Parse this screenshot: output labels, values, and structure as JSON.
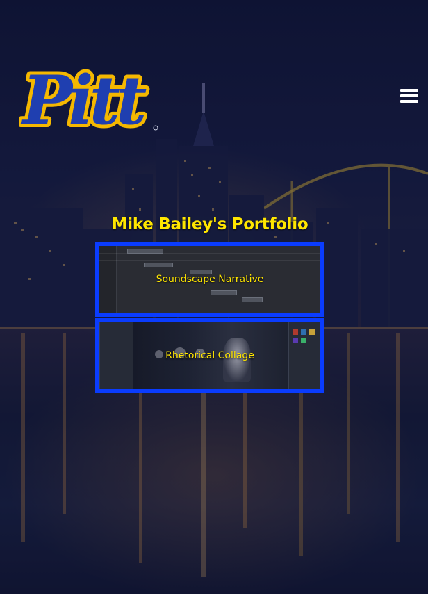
{
  "header": {
    "logo_text": "Pitt",
    "menu_icon": "hamburger-menu-icon"
  },
  "main": {
    "title": "Mike Bailey's Portfolio",
    "cards": [
      {
        "label": "Soundscape Narrative"
      },
      {
        "label": "Rhetorical Collage"
      }
    ]
  },
  "colors": {
    "title_yellow": "#ffe600",
    "card_border_blue": "#0a3cff",
    "logo_blue": "#1f3fb0",
    "logo_gold": "#f5b800"
  }
}
